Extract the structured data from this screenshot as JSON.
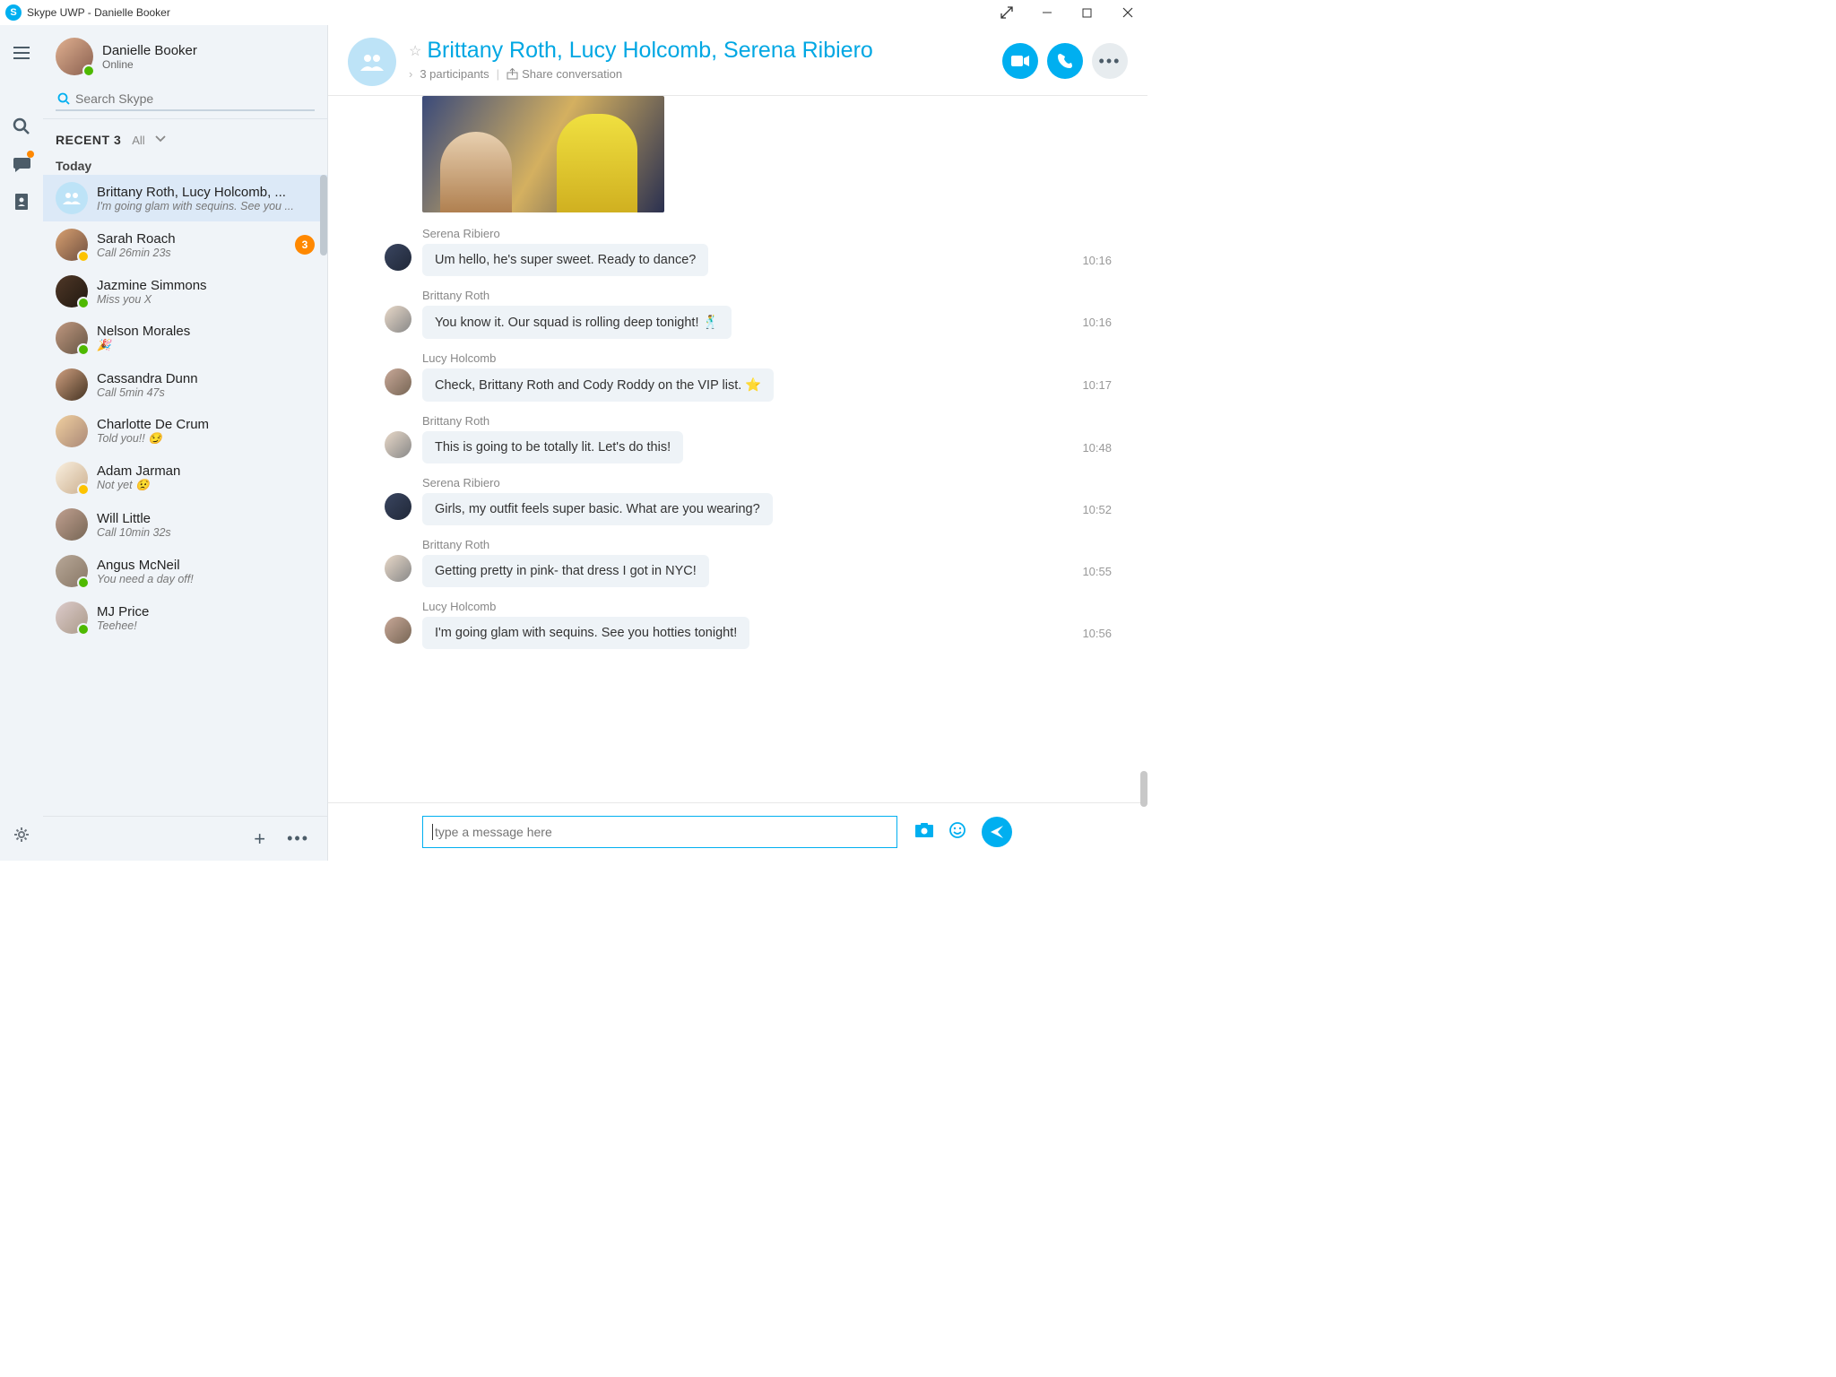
{
  "window": {
    "title": "Skype UWP - Danielle Booker"
  },
  "profile": {
    "name": "Danielle Booker",
    "status": "Online"
  },
  "search": {
    "placeholder": "Search Skype"
  },
  "recent": {
    "label": "RECENT 3",
    "filter": "All",
    "day": "Today"
  },
  "contacts": [
    {
      "name": "Brittany Roth, Lucy Holcomb, ...",
      "preview": "I'm going glam with sequins. See you ...",
      "group": true,
      "active": true
    },
    {
      "name": "Sarah Roach",
      "preview": "Call 26min 23s",
      "badge": "3",
      "presence": "away"
    },
    {
      "name": "Jazmine Simmons",
      "preview": "Miss you X",
      "presence": "online"
    },
    {
      "name": "Nelson Morales",
      "preview": "🎉",
      "presence": "online"
    },
    {
      "name": "Cassandra Dunn",
      "preview": "Call 5min 47s"
    },
    {
      "name": "Charlotte De Crum",
      "preview": "Told you!! 😏"
    },
    {
      "name": "Adam Jarman",
      "preview": "Not yet 😟",
      "presence": "away"
    },
    {
      "name": "Will Little",
      "preview": "Call 10min 32s"
    },
    {
      "name": "Angus McNeil",
      "preview": "You need a day off!",
      "presence": "online"
    },
    {
      "name": "MJ Price",
      "preview": "Teehee!",
      "presence": "online"
    }
  ],
  "conversation": {
    "title": "Brittany Roth, Lucy Holcomb, Serena Ribiero",
    "participants": "3 participants",
    "share": "Share conversation"
  },
  "messages": [
    {
      "sender": "Serena Ribiero",
      "text": "Um hello, he's super sweet. Ready to dance?",
      "time": "10:16",
      "av": "sr"
    },
    {
      "sender": "Brittany Roth",
      "text": "You know it. Our squad is rolling deep tonight! 🕺",
      "time": "10:16",
      "av": "br"
    },
    {
      "sender": "Lucy Holcomb",
      "text": "Check, Brittany Roth and Cody Roddy on the VIP list. ⭐",
      "time": "10:17",
      "av": "lh"
    },
    {
      "sender": "Brittany Roth",
      "text": "This is going to be totally lit. Let's do this!",
      "time": "10:48",
      "av": "br"
    },
    {
      "sender": "Serena Ribiero",
      "text": "Girls, my outfit feels super basic. What are you wearing?",
      "time": "10:52",
      "av": "sr"
    },
    {
      "sender": "Brittany Roth",
      "text": "Getting pretty in pink- that dress I got in NYC!",
      "time": "10:55",
      "av": "br"
    },
    {
      "sender": "Lucy Holcomb",
      "text": "I'm going glam with sequins. See you hotties tonight!",
      "time": "10:56",
      "av": "lh"
    }
  ],
  "composer": {
    "placeholder": "type a message here"
  }
}
